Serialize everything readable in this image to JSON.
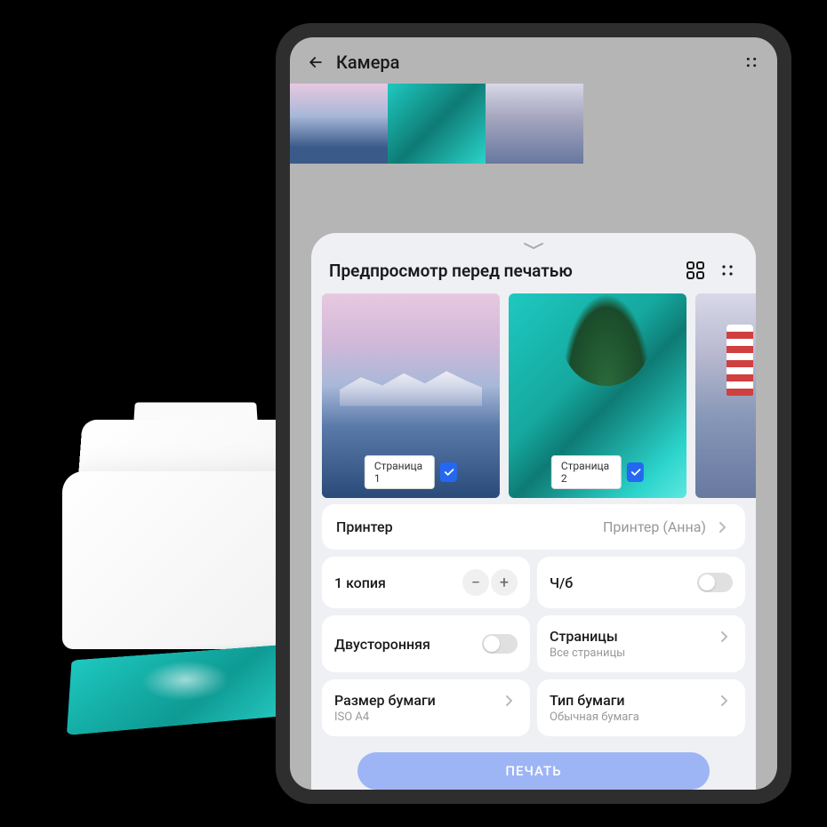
{
  "header": {
    "title": "Камера"
  },
  "panel": {
    "title": "Предпросмотр перед печатью",
    "pages": [
      {
        "label": "Страница 1",
        "checked": true
      },
      {
        "label": "Страница 2",
        "checked": true
      }
    ]
  },
  "settings": {
    "printer": {
      "label": "Принтер",
      "value": "Принтер (Анна)"
    },
    "copies": {
      "label": "1 копия"
    },
    "bw": {
      "label": "Ч/б",
      "on": false
    },
    "duplex": {
      "label": "Двусторонняя",
      "on": false
    },
    "pages": {
      "label": "Страницы",
      "value": "Все страницы"
    },
    "paperSize": {
      "label": "Размер бумаги",
      "value": "ISO A4"
    },
    "paperType": {
      "label": "Тип бумаги",
      "value": "Обычная бумага"
    }
  },
  "printButton": "ПЕЧАТЬ"
}
